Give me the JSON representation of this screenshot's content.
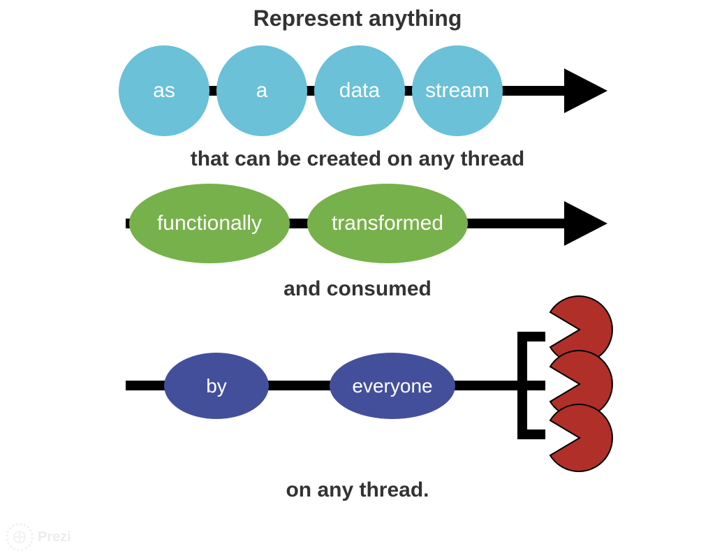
{
  "title": "Represent anything",
  "row1": {
    "nodes": [
      "as",
      "a",
      "data",
      "stream"
    ]
  },
  "subtitle1": "that can be created on any thread",
  "row2": {
    "nodes": [
      "functionally",
      "transformed"
    ]
  },
  "subtitle2": "and consumed",
  "row3": {
    "nodes": [
      "by",
      "everyone"
    ]
  },
  "footer": "on any thread.",
  "watermark": "Prezi",
  "colors": {
    "blue": "#6ac1d8",
    "green": "#77b14b",
    "purple": "#444f9b",
    "red": "#b12f29"
  }
}
